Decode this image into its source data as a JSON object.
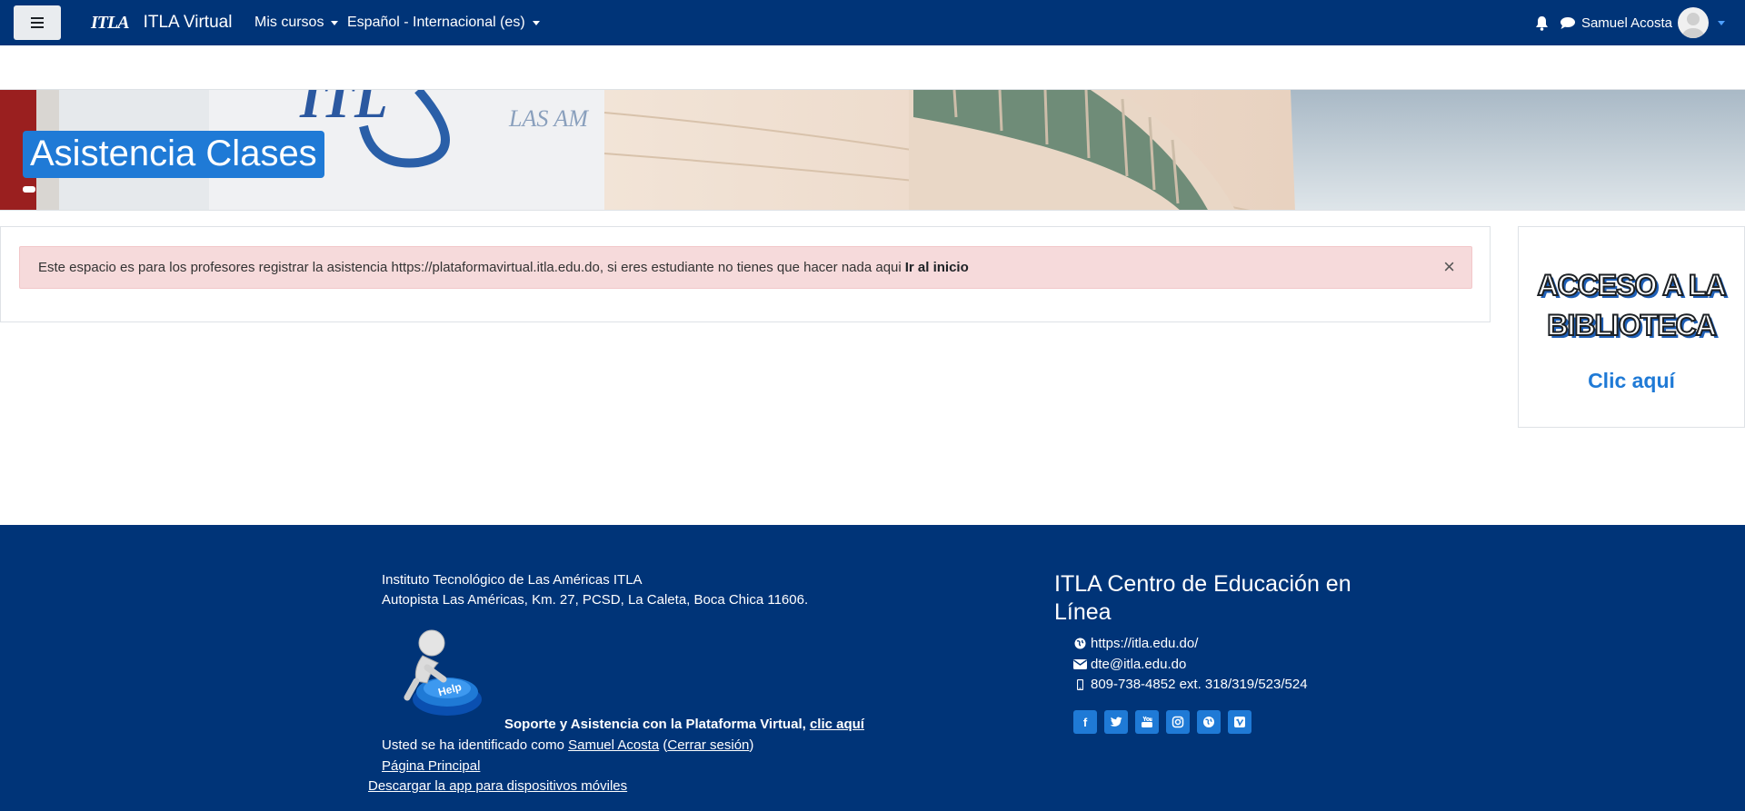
{
  "navbar": {
    "menu_icon": "hamburger-icon",
    "logo_text": "ITLA",
    "site_name": "ITLA Virtual",
    "my_courses": "Mis cursos",
    "language": "Español - Internacional (es)",
    "user_name": "Samuel Acosta",
    "icons": [
      "bell-icon",
      "chat-icon",
      "avatar",
      "caret-down-icon"
    ]
  },
  "header": {
    "page_title": "Asistencia Clases"
  },
  "alert": {
    "message": "Este espacio es para los profesores registrar la asistencia https://plataformavirtual.itla.edu.do, si eres estudiante no tienes que hacer nada aqui",
    "link_text": "Ir al inicio",
    "close": "×"
  },
  "library_block": {
    "title_line1": "ACCESO A LA",
    "title_line2": "BIBLIOTECA",
    "link": "Clic aquí"
  },
  "footer": {
    "institution": "Instituto Tecnológico de Las Américas ITLA",
    "address": "Autopista Las Américas, Km. 27, PCSD, La Caleta, Boca Chica 11606.",
    "support_text": "Soporte y Asistencia con la Plataforma Virtual,",
    "support_link": "clic aquí",
    "logged_in_prefix": "Usted se ha identificado como",
    "logged_in_user": "Samuel Acosta",
    "logout_open": "(",
    "logout": "Cerrar sesión",
    "logout_close": ")",
    "home": "Página Principal",
    "app_download": "Descargar la app para dispositivos móviles",
    "center_title": "ITLA Centro de Educación en Línea",
    "website": "https://itla.edu.do/",
    "email": "dte@itla.edu.do",
    "phone": "809-738-4852 ext. 318/319/523/524",
    "help_badge": "Help",
    "social_icons": [
      "facebook-icon",
      "twitter-icon",
      "youtube-icon",
      "instagram-icon",
      "globe-icon",
      "vimeo-icon"
    ]
  },
  "colors": {
    "navbar": "#003478",
    "accent": "#1f7ad6",
    "alert_bg": "#f6dadb"
  }
}
